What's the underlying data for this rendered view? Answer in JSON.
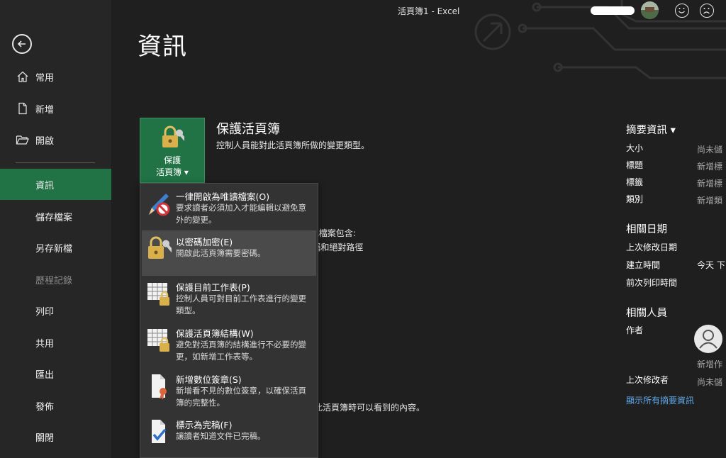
{
  "window": {
    "title": "活頁簿1  -  Excel"
  },
  "sidebar": {
    "items": [
      {
        "label": "常用",
        "icon": "home-icon"
      },
      {
        "label": "新增",
        "icon": "new-document-icon"
      },
      {
        "label": "開啟",
        "icon": "open-folder-icon"
      },
      {
        "label": "資訊",
        "active": true
      },
      {
        "label": "儲存檔案"
      },
      {
        "label": "另存新檔"
      },
      {
        "label": "歷程記錄",
        "disabled": true
      },
      {
        "label": "列印"
      },
      {
        "label": "共用"
      },
      {
        "label": "匯出"
      },
      {
        "label": "發佈"
      },
      {
        "label": "關閉"
      }
    ]
  },
  "page": {
    "title": "資訊"
  },
  "protect": {
    "button_line1": "保護",
    "button_line2": "活頁簿 ▾",
    "heading": "保護活頁簿",
    "description": "控制人員能對此活頁簿所做的變更類型。"
  },
  "background_text": {
    "inspect_line1": "t此檔案包含:",
    "inspect_line2": "a稱和絕對路徑",
    "browser_view": "此活頁簿時可以看到的內容。"
  },
  "dropdown": {
    "items": [
      {
        "title": "一律開啟為唯讀檔案(O)",
        "desc": "要求讀者必須加入才能編輯以避免意外的變更。",
        "icon": "pencil-no-icon"
      },
      {
        "title": "以密碼加密(E)",
        "desc": "開啟此活頁簿需要密碼。",
        "icon": "lock-key-icon",
        "highlighted": true
      },
      {
        "title": "保護目前工作表(P)",
        "desc": "控制人員可對目前工作表進行的變更類型。",
        "icon": "sheet-lock-icon"
      },
      {
        "title": "保護活頁簿結構(W)",
        "desc": "避免對活頁簿的結構進行不必要的變更，如新增工作表等。",
        "icon": "workbook-lock-icon"
      },
      {
        "title": "新增數位簽章(S)",
        "desc": "新增看不見的數位簽章，以確保活頁簿的完整性。",
        "icon": "signature-ribbon-icon"
      },
      {
        "title": "標示為完稿(F)",
        "desc": "讓讀者知道文件已完稿。",
        "icon": "document-check-icon"
      }
    ]
  },
  "properties": {
    "heading": "摘要資訊 ▾",
    "rows": [
      {
        "label": "大小",
        "value": "尚未儲"
      },
      {
        "label": "標題",
        "value": "新增標"
      },
      {
        "label": "標籤",
        "value": "新增標"
      },
      {
        "label": "類別",
        "value": "新增類"
      }
    ],
    "dates_heading": "相關日期",
    "dates": [
      {
        "label": "上次修改日期",
        "value": ""
      },
      {
        "label": "建立時間",
        "value": "今天 下"
      },
      {
        "label": "前次列印時間",
        "value": ""
      }
    ],
    "people_heading": "相關人員",
    "author_label": "作者",
    "author_value": "新增作",
    "last_modified_by_label": "上次修改者",
    "last_modified_by_value": "尚未儲",
    "show_all": "顯示所有摘要資訊"
  },
  "colors": {
    "accent": "#217346",
    "link": "#5fa8e8",
    "background": "#1f1f1f"
  }
}
